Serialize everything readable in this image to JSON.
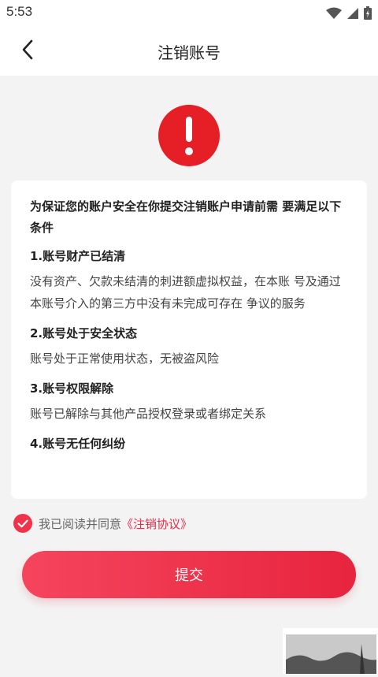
{
  "status": {
    "time": "5:53"
  },
  "header": {
    "title": "注销账号"
  },
  "card": {
    "intro": "为保证您的账户安全在你提交注销账户申请前需 要满足以下条件",
    "conditions": [
      {
        "title": "1.账号财产已结清",
        "desc": "没有资产、欠款未结清的刺进额虚拟权益，在本账 号及通过本账号介入的第三方中没有未完成可存在 争议的服务"
      },
      {
        "title": "2.账号处于安全状态",
        "desc": "账号处于正常使用状态，无被盗风险"
      },
      {
        "title": "3.账号权限解除",
        "desc": "账号已解除与其他产品授权登录或者绑定关系"
      },
      {
        "title": "4.账号无任何纠纷",
        "desc": ""
      }
    ]
  },
  "agreement": {
    "text": "我已阅读并同意",
    "link": "《注销协议》",
    "checked": true
  },
  "submit": {
    "label": "提交"
  },
  "colors": {
    "accent": "#ea2b4a",
    "background": "#f3f3f3"
  }
}
